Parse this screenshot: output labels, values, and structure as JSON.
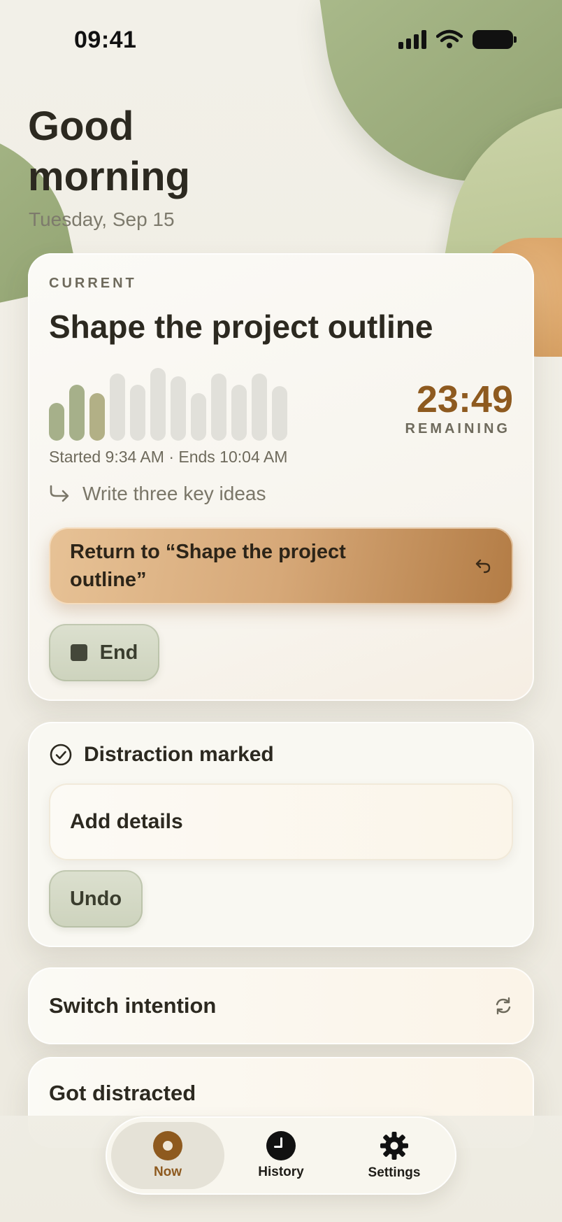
{
  "status_bar": {
    "time": "09:41"
  },
  "header": {
    "greeting": "Good morning",
    "date": "Tuesday, Sep 15"
  },
  "current": {
    "overline": "CURRENT",
    "title": "Shape the project outline",
    "countdown": "23:49",
    "remaining_label": "REMAINING",
    "times": "Started 9:34 AM · Ends 10:04 AM",
    "next_step": "Write three key ideas",
    "return_label": "Return to “Shape the project outline”",
    "end_label": "End",
    "progress_segments_total": 12,
    "progress_segments_elapsed": 3,
    "colors": {
      "elapsed": "#a7b08a",
      "remaining": "#e1e0da",
      "accent": "#8e5a1f"
    }
  },
  "distraction": {
    "status": "Distraction marked",
    "details_placeholder": "Add details",
    "undo_label": "Undo"
  },
  "actions": {
    "switch_label": "Switch intention",
    "distracted_label": "Got distracted"
  },
  "tabbar": {
    "items": [
      {
        "label": "Now",
        "icon": "target-icon",
        "active": true
      },
      {
        "label": "History",
        "icon": "clock-icon",
        "active": false
      },
      {
        "label": "Settings",
        "icon": "gear-icon",
        "active": false
      }
    ]
  }
}
